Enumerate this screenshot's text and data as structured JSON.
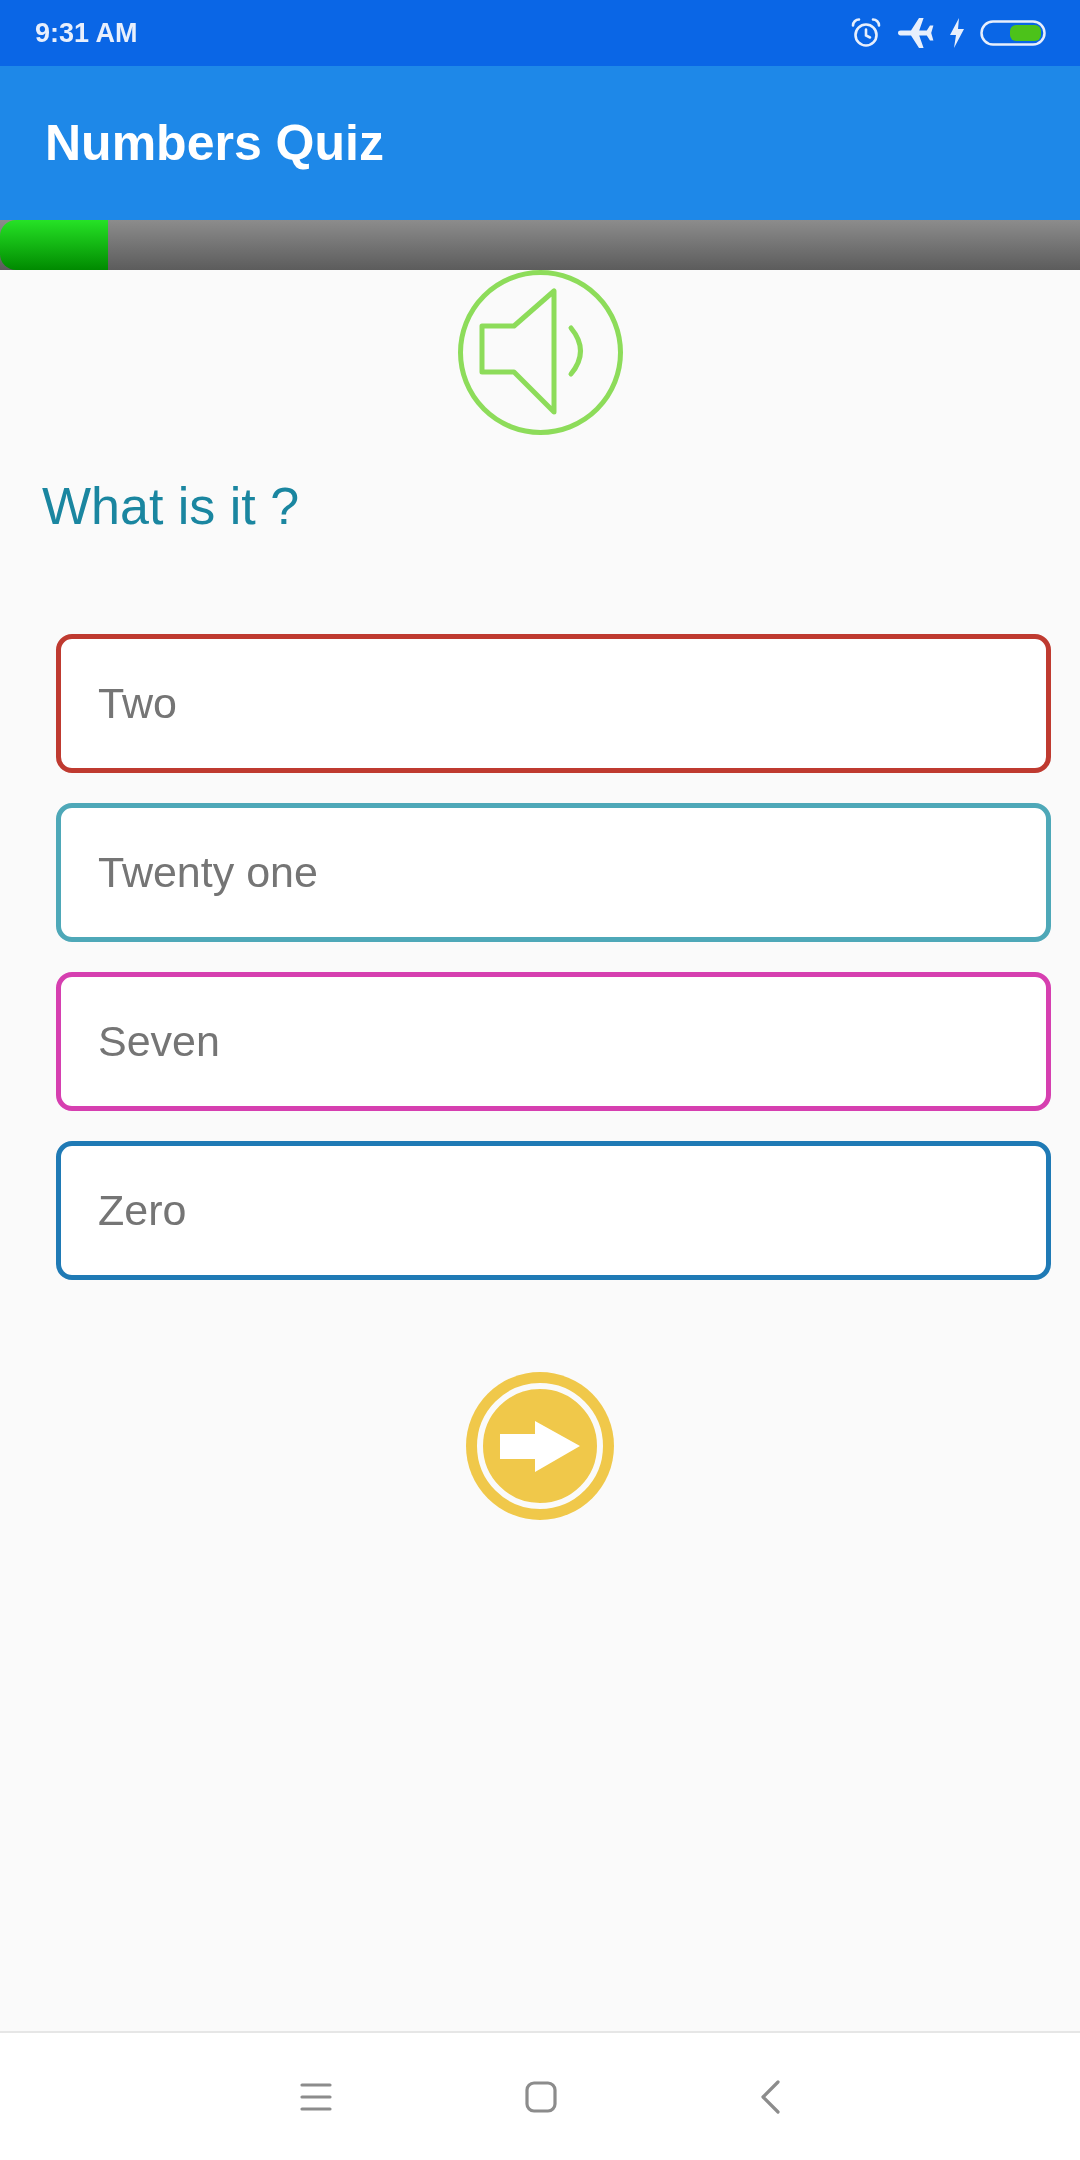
{
  "status_bar": {
    "time": "9:31 AM"
  },
  "app_bar": {
    "title": "Numbers Quiz"
  },
  "progress": {
    "level": 0.1
  },
  "question": {
    "prompt": "What is it ?"
  },
  "options": [
    {
      "label": "Two",
      "color": "#bf3a30"
    },
    {
      "label": "Twenty one",
      "color": "#4ea8b8"
    },
    {
      "label": "Seven",
      "color": "#d63fb0"
    },
    {
      "label": "Zero",
      "color": "#1f7ab5"
    }
  ]
}
